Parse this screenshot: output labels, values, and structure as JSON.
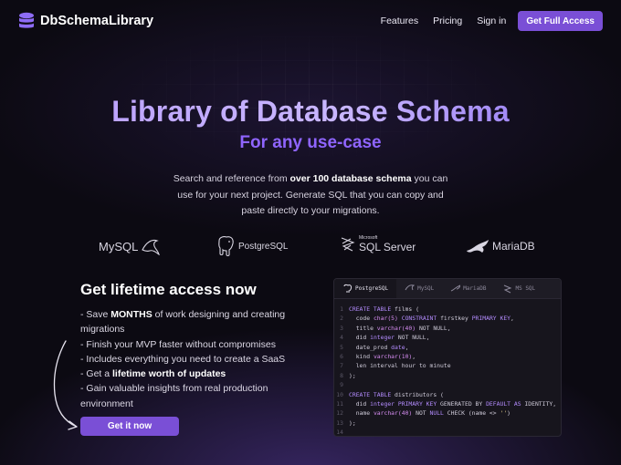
{
  "nav": {
    "brand": "DbSchemaLibrary",
    "links": [
      "Features",
      "Pricing",
      "Sign in"
    ],
    "cta": "Get Full Access"
  },
  "hero": {
    "title": "Library of Database Schema",
    "subtitle": "For any use-case",
    "desc_part1": "Search and reference from ",
    "desc_bold": "over 100 database schema",
    "desc_part2": " you can use for your next project. Generate SQL that you can copy and paste directly to your migrations."
  },
  "logos": {
    "mysql": "MySQL",
    "postgres": "PostgreSQL",
    "sqlserver_small": "Microsoft",
    "sqlserver": "SQL Server",
    "mariadb": "MariaDB"
  },
  "access": {
    "title": "Get lifetime access now",
    "items": [
      {
        "pre": "- Save ",
        "bold": "MONTHS",
        "post": " of work designing and creating migrations"
      },
      {
        "pre": "- Finish your MVP faster without compromises",
        "bold": "",
        "post": ""
      },
      {
        "pre": "- Includes everything you need to create a SaaS",
        "bold": "",
        "post": ""
      },
      {
        "pre": "- Get a ",
        "bold": "lifetime worth of updates",
        "post": ""
      },
      {
        "pre": "- Gain valuable insights from real production environment",
        "bold": "",
        "post": ""
      }
    ],
    "cta": "Get it now"
  },
  "code_window": {
    "tabs": [
      "PostgreSQL",
      "MySQL",
      "MariaDB",
      "MS SQL"
    ],
    "active_tab": 0,
    "line_numbers": [
      "1",
      "2",
      "3",
      "4",
      "5",
      "6",
      "7",
      "8",
      "9",
      "10",
      "11",
      "12",
      "13",
      "14"
    ],
    "lines": [
      [
        {
          "t": "CREATE TABLE",
          "c": "kw"
        },
        {
          "t": " films (",
          "c": ""
        }
      ],
      [
        {
          "t": "  code ",
          "c": ""
        },
        {
          "t": "char(5)",
          "c": "fn"
        },
        {
          "t": " ",
          "c": ""
        },
        {
          "t": "CONSTRAINT",
          "c": "kw"
        },
        {
          "t": " firstkey ",
          "c": ""
        },
        {
          "t": "PRIMARY KEY",
          "c": "kw"
        },
        {
          "t": ",",
          "c": ""
        }
      ],
      [
        {
          "t": "  title ",
          "c": ""
        },
        {
          "t": "varchar(40)",
          "c": "fn"
        },
        {
          "t": " NOT NULL,",
          "c": ""
        }
      ],
      [
        {
          "t": "  did ",
          "c": ""
        },
        {
          "t": "integer",
          "c": "kw"
        },
        {
          "t": " NOT NULL,",
          "c": ""
        }
      ],
      [
        {
          "t": "  date_prod ",
          "c": ""
        },
        {
          "t": "date",
          "c": "kw"
        },
        {
          "t": ",",
          "c": ""
        }
      ],
      [
        {
          "t": "  kind ",
          "c": ""
        },
        {
          "t": "varchar(10)",
          "c": "fn"
        },
        {
          "t": ",",
          "c": ""
        }
      ],
      [
        {
          "t": "  len interval hour to minute",
          "c": ""
        }
      ],
      [
        {
          "t": ");",
          "c": ""
        }
      ],
      [],
      [
        {
          "t": "CREATE TABLE",
          "c": "kw"
        },
        {
          "t": " distributors (",
          "c": ""
        }
      ],
      [
        {
          "t": "  did ",
          "c": ""
        },
        {
          "t": "integer PRIMARY KEY",
          "c": "kw"
        },
        {
          "t": " GENERATED BY ",
          "c": ""
        },
        {
          "t": "DEFAULT AS",
          "c": "kw"
        },
        {
          "t": " IDENTITY,",
          "c": ""
        }
      ],
      [
        {
          "t": "  name ",
          "c": ""
        },
        {
          "t": "varchar(40)",
          "c": "fn"
        },
        {
          "t": " NOT ",
          "c": ""
        },
        {
          "t": "NULL",
          "c": "kw"
        },
        {
          "t": " CHECK (name <> ",
          "c": ""
        },
        {
          "t": "''",
          "c": "st"
        },
        {
          "t": ")",
          "c": ""
        }
      ],
      [
        {
          "t": ");",
          "c": ""
        }
      ],
      []
    ]
  },
  "colors": {
    "accent": "#7a4fd6",
    "subtitle": "#8f65ff",
    "background": "#0c0a12",
    "code_keyword": "#b48cff"
  }
}
